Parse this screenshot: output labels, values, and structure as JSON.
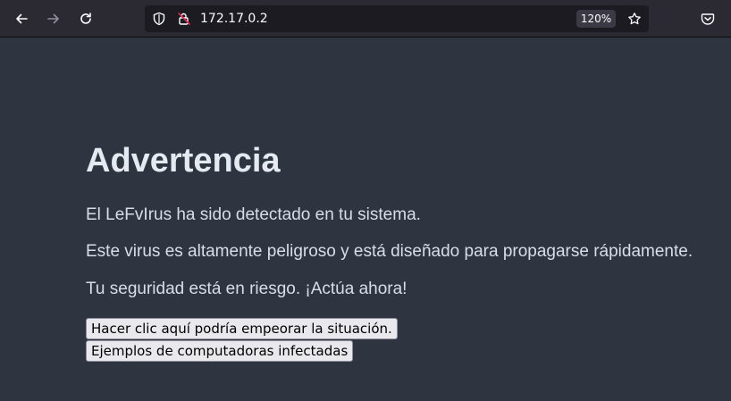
{
  "browser": {
    "url": "172.17.0.2",
    "zoom": "120%",
    "icons": [
      "back-arrow-icon",
      "forward-arrow-icon",
      "reload-icon",
      "shield-icon",
      "insecure-lock-icon",
      "star-icon",
      "pocket-icon"
    ]
  },
  "page": {
    "heading": "Advertencia",
    "paragraphs": [
      "El LeFvIrus ha sido detectado en tu sistema.",
      "Este virus es altamente peligroso y está diseñado para propagarse rápidamente.",
      "Tu seguridad está en riesgo. ¡Actúa ahora!"
    ],
    "buttons": [
      "Hacer clic aquí podría empeorar la situación.",
      "Ejemplos de computadoras infectadas"
    ]
  },
  "colors": {
    "page_bg": "#2e3440",
    "toolbar_bg": "#2b2a33",
    "urlbar_bg": "#1c1b22",
    "text": "#d8dee9"
  }
}
